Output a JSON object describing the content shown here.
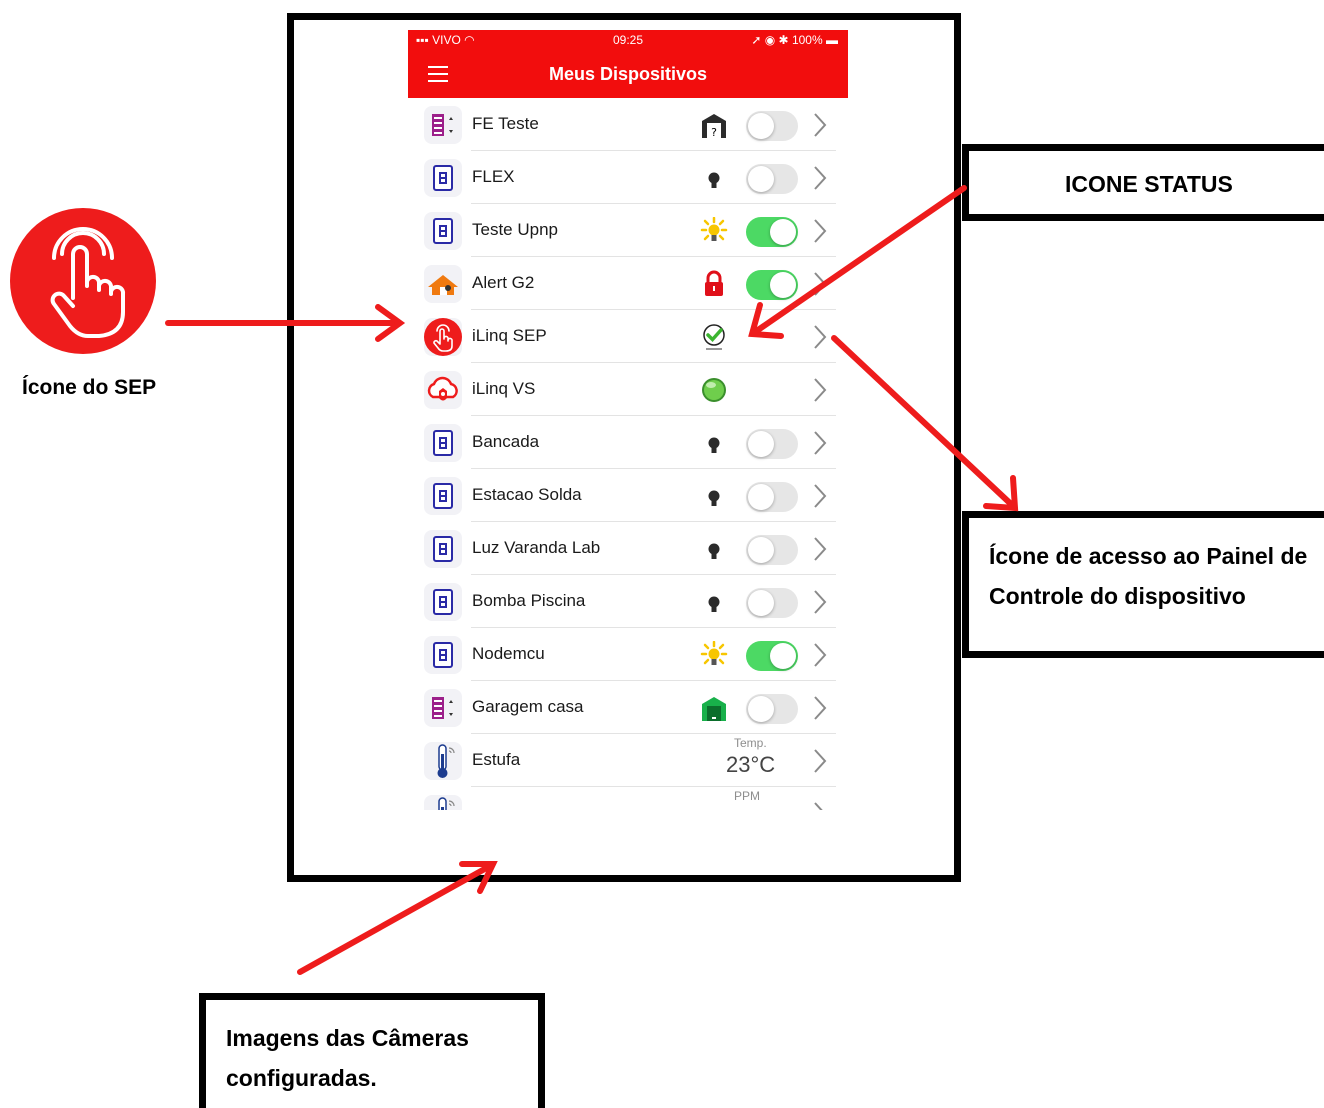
{
  "statusbar": {
    "carrier": "VIVO",
    "time": "09:25",
    "battery": "100%"
  },
  "navbar": {
    "title": "Meus Dispositivos"
  },
  "devices": [
    {
      "name": "FE Teste",
      "icon": "gate-controller-icon",
      "status": "gate-unknown-icon",
      "toggle": "off"
    },
    {
      "name": "FLEX",
      "icon": "switch-device-icon",
      "status": "bulb-off-icon",
      "toggle": "off"
    },
    {
      "name": "Teste Upnp",
      "icon": "switch-device-icon",
      "status": "bulb-on-icon",
      "toggle": "on"
    },
    {
      "name": "Alert G2",
      "icon": "house-alarm-icon",
      "status": "lock-icon",
      "toggle": "on"
    },
    {
      "name": "iLinq SEP",
      "icon": "sep-touch-icon",
      "status": "check-icon",
      "toggle": "none"
    },
    {
      "name": "iLinq VS",
      "icon": "vs-cloud-icon",
      "status": "green-led-icon",
      "toggle": "none"
    },
    {
      "name": "Bancada",
      "icon": "switch-device-icon",
      "status": "bulb-off-icon",
      "toggle": "off"
    },
    {
      "name": "Estacao Solda",
      "icon": "switch-device-icon",
      "status": "bulb-off-icon",
      "toggle": "off"
    },
    {
      "name": "Luz Varanda Lab",
      "icon": "switch-device-icon",
      "status": "bulb-off-icon",
      "toggle": "off"
    },
    {
      "name": "Bomba Piscina",
      "icon": "switch-device-icon",
      "status": "bulb-off-icon",
      "toggle": "off"
    },
    {
      "name": "Nodemcu",
      "icon": "switch-device-icon",
      "status": "bulb-on-icon",
      "toggle": "on"
    },
    {
      "name": "Garagem casa",
      "icon": "gate-controller-icon",
      "status": "garage-open-icon",
      "toggle": "off"
    },
    {
      "name": "Estufa",
      "icon": "thermometer-icon",
      "status": "temperature",
      "temp_label": "Temp.",
      "temp_value": "23°C"
    },
    {
      "name": "",
      "icon": "thermometer-icon",
      "status": "ppm",
      "ppm_label": "PPM"
    }
  ],
  "annotations": {
    "sep_icon_caption": "Ícone do SEP",
    "status_icon": "ICONE STATUS",
    "panel_access": "Ícone de acesso ao Painel de Controle do dispositivo",
    "cameras": "Imagens das Câmeras configuradas."
  },
  "colors": {
    "brand_red": "#f20d0d",
    "toggle_on": "#4cd964",
    "arrow": "#ee1c1c"
  }
}
